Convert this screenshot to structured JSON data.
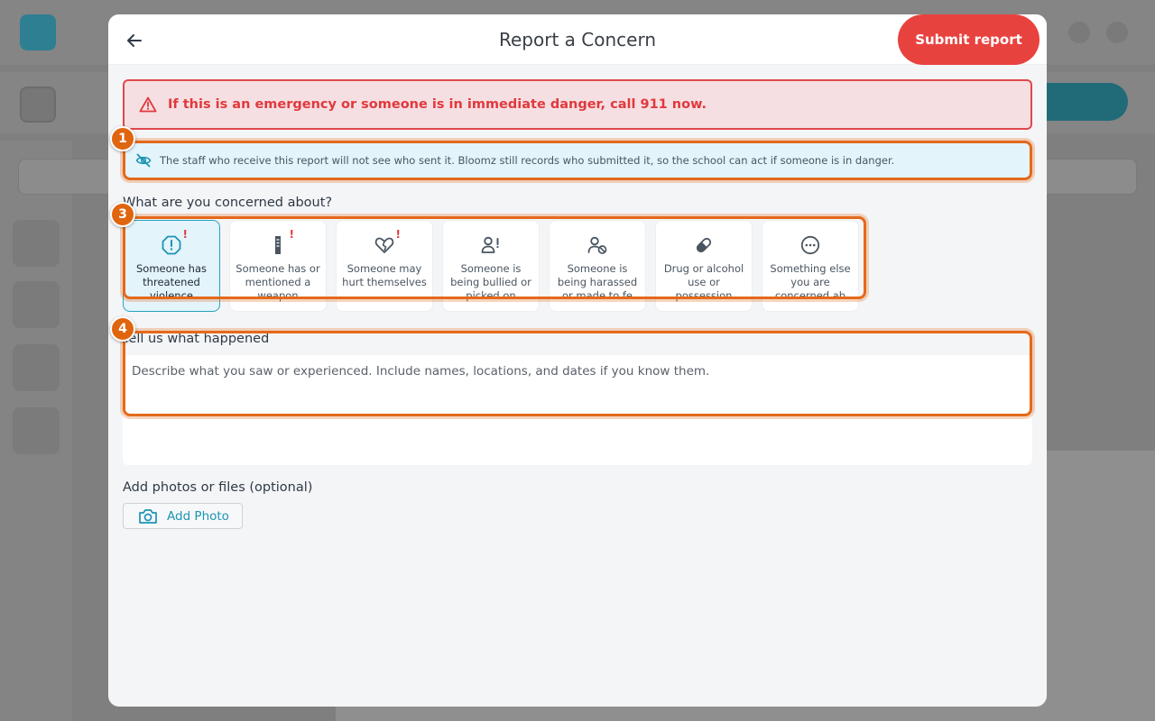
{
  "modal": {
    "title": "Report a Concern",
    "submit_label": "Submit report"
  },
  "emergency": {
    "text": "If this is an emergency or someone is in immediate danger, call 911 now."
  },
  "anonymous_note": {
    "text": "The staff who receive this report will not see who sent it. Bloomz still records who submitted it, so the school can act if someone is in danger."
  },
  "concern": {
    "label": "What are you concerned about?",
    "selected_index": 0,
    "options": [
      {
        "label": "Someone has threatened violence",
        "icon": "alert-octagon-icon"
      },
      {
        "label": "Someone has or mentioned a weapon",
        "icon": "weapon-icon"
      },
      {
        "label": "Someone may hurt themselves",
        "icon": "broken-heart-icon"
      },
      {
        "label": "Someone is being bullied or picked on",
        "icon": "person-alert-icon"
      },
      {
        "label": "Someone is being harassed or made to fe",
        "icon": "person-blocked-icon"
      },
      {
        "label": "Drug or alcohol use or possession",
        "icon": "pill-icon"
      },
      {
        "label": "Something else you are concerned ab",
        "icon": "more-circle-icon"
      }
    ]
  },
  "story": {
    "label": "Tell us what happened",
    "placeholder": "Describe what you saw or experienced. Include names, locations, and dates if you know them."
  },
  "attachments": {
    "label": "Add photos or files (optional)",
    "button_label": "Add Photo"
  },
  "annotations": [
    "1",
    "3",
    "4"
  ],
  "colors": {
    "danger": "#e0393d",
    "accent": "#1d94b3",
    "highlight": "#e4691a"
  }
}
